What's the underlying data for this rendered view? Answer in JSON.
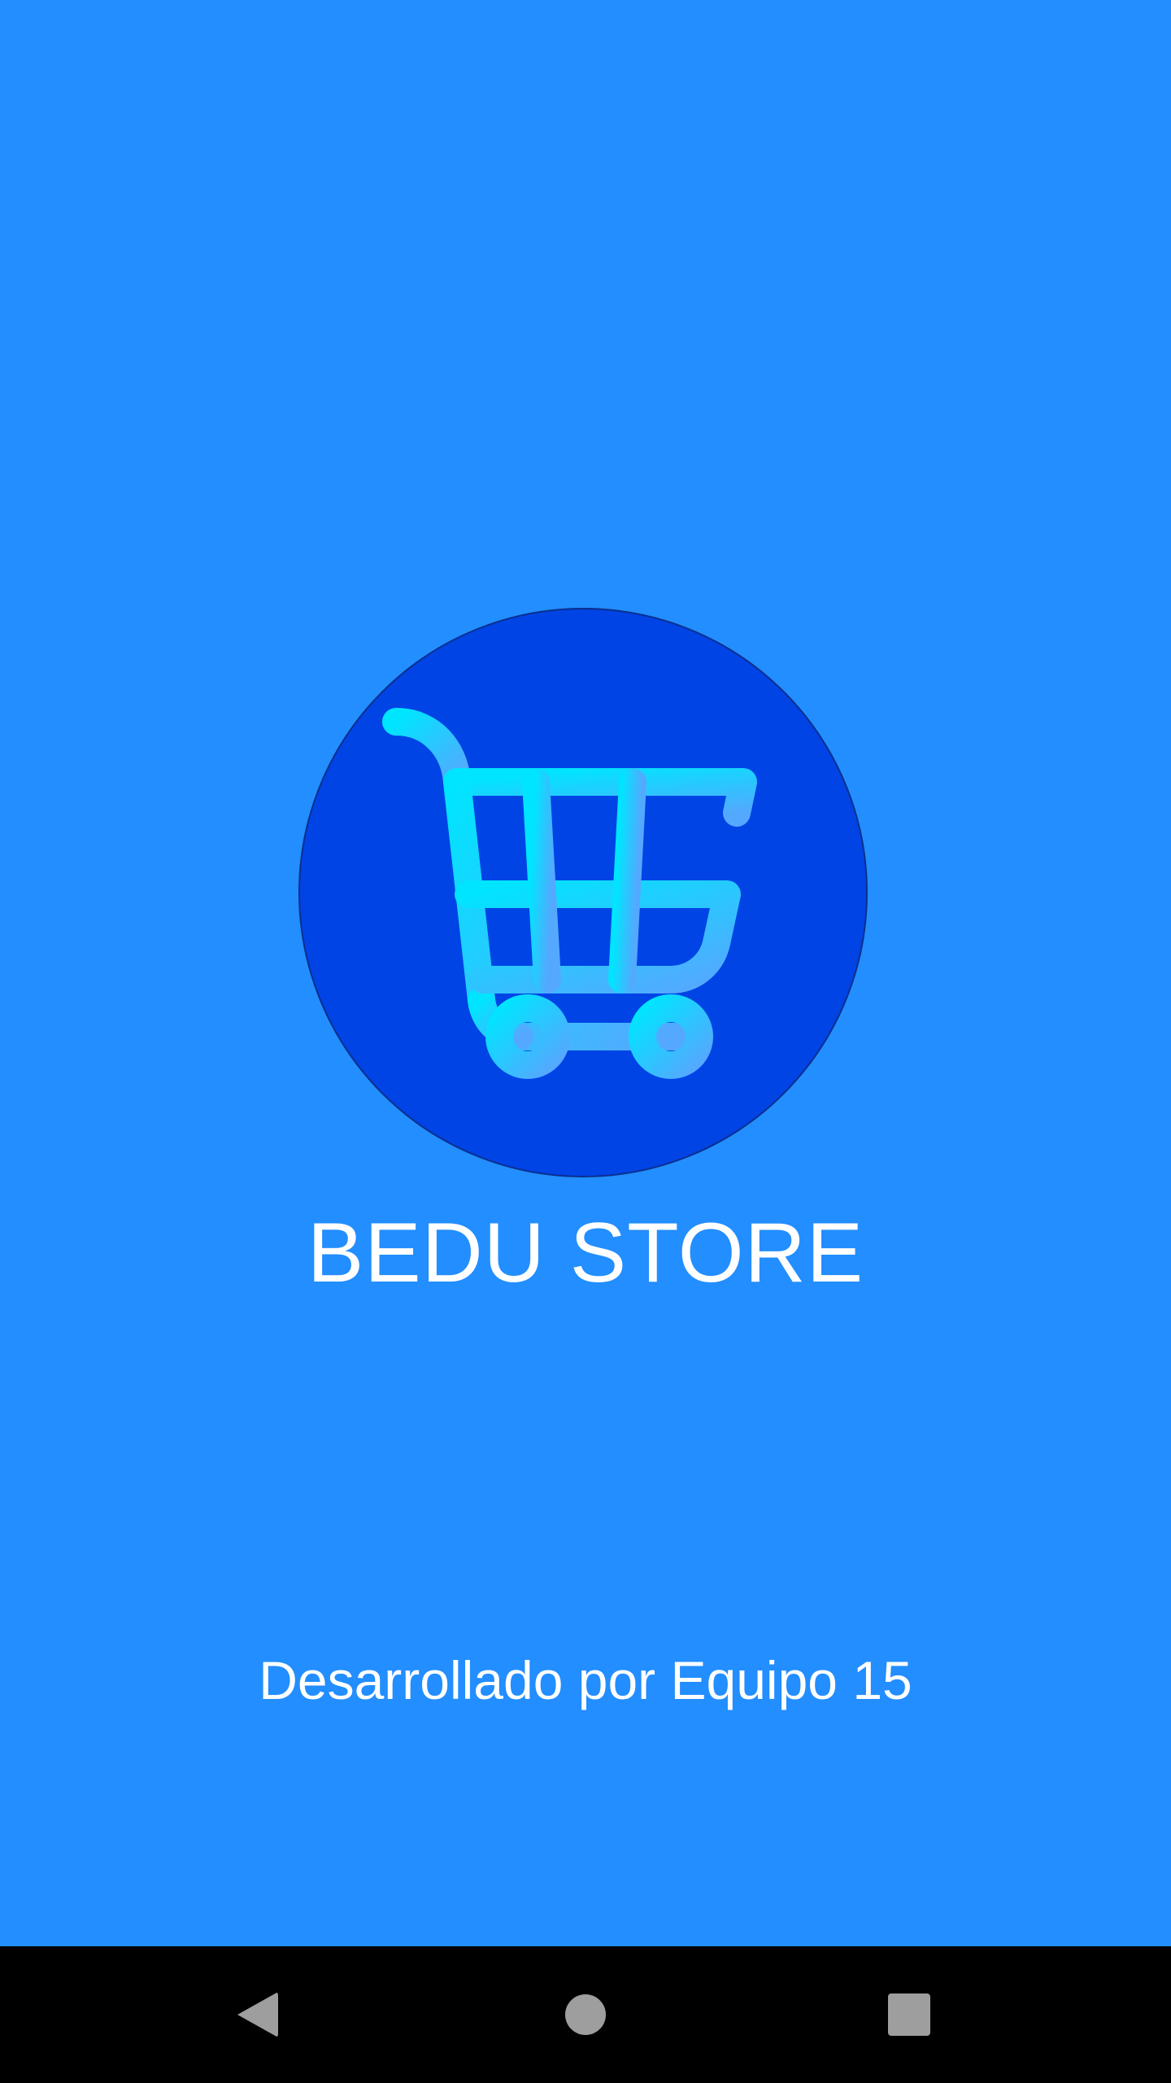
{
  "app": {
    "title": "BEDU STORE",
    "credits": "Desarrollado por Equipo 15"
  },
  "logo": {
    "icon": "shopping-cart-icon",
    "circle_color": "#0044E6",
    "cart_gradient": [
      "#00E5FF",
      "#4FB0FF"
    ]
  },
  "theme": {
    "background": "#228EFF",
    "nav_background": "#000000",
    "nav_icon_color": "#9E9E9E"
  },
  "navigation": {
    "back_icon": "back-triangle-icon",
    "home_icon": "home-circle-icon",
    "recents_icon": "recents-square-icon"
  }
}
